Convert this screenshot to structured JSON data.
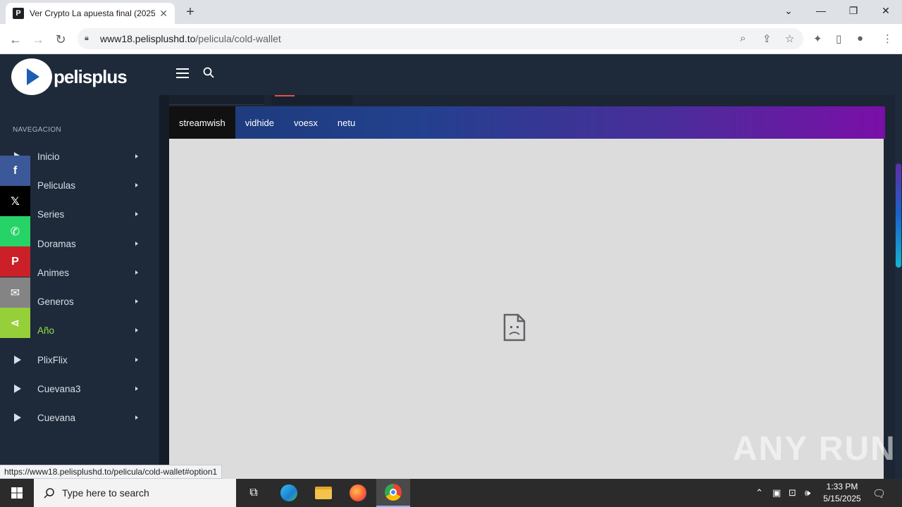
{
  "browser": {
    "tab_title": "Ver Crypto La apuesta final (2025",
    "tab_favicon": "P",
    "url_host": "www18.pelisplushd.to",
    "url_path": "/pelicula/cold-wallet",
    "status_url": "https://www18.pelisplushd.to/pelicula/cold-wallet#option1"
  },
  "site": {
    "brand": "pelisplus",
    "nav_label": "NAVEGACION",
    "menu": [
      {
        "label": "Inicio"
      },
      {
        "label": "Peliculas"
      },
      {
        "label": "Series"
      },
      {
        "label": "Doramas"
      },
      {
        "label": "Animes"
      },
      {
        "label": "Generos"
      },
      {
        "label": "Año",
        "active": true
      },
      {
        "label": "PlixFlix"
      },
      {
        "label": "Cuevana3"
      },
      {
        "label": "Cuevana"
      }
    ],
    "share_buttons": [
      {
        "icon": "facebook-icon",
        "glyph": "f",
        "color": "#3b5998"
      },
      {
        "icon": "x-icon",
        "glyph": "𝕏",
        "color": "#000000"
      },
      {
        "icon": "whatsapp-icon",
        "glyph": "✆",
        "color": "#25d366"
      },
      {
        "icon": "pinterest-icon",
        "glyph": "P",
        "color": "#cb2027"
      },
      {
        "icon": "email-icon",
        "glyph": "✉",
        "color": "#848484"
      },
      {
        "icon": "share-icon",
        "glyph": "⋖",
        "color": "#95d03a"
      }
    ],
    "servers": [
      {
        "label": "streamwish",
        "active": true
      },
      {
        "label": "vidhide"
      },
      {
        "label": "voesx"
      },
      {
        "label": "netu"
      }
    ]
  },
  "watermark": "ANY RUN",
  "taskbar": {
    "search_placeholder": "Type here to search",
    "time": "1:33 PM",
    "date": "5/15/2025"
  },
  "colors": {
    "accent_active": "#8fe04a",
    "header_bg": "#1e2a3a"
  }
}
